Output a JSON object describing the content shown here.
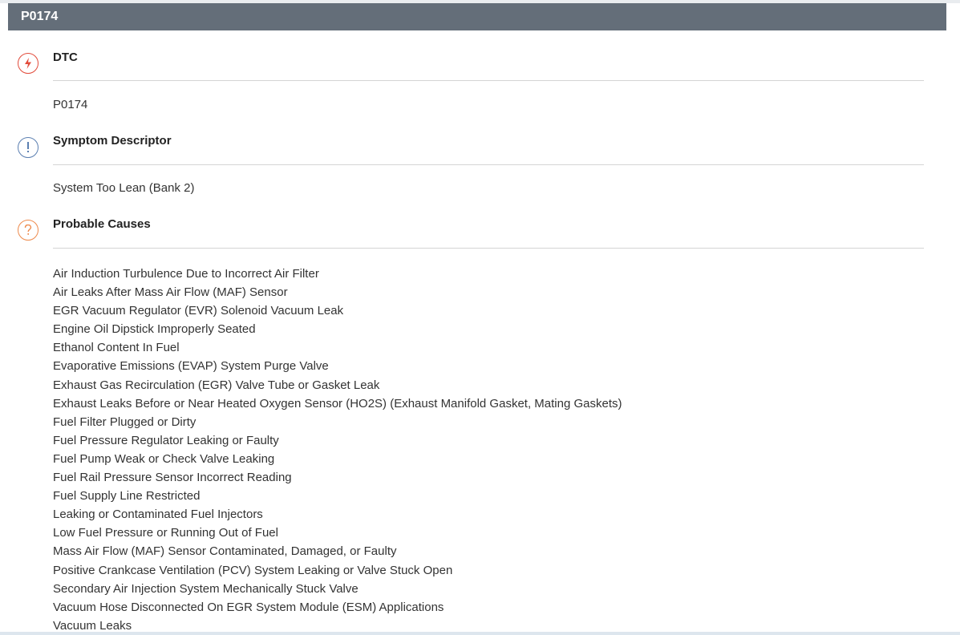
{
  "header": {
    "code": "P0174"
  },
  "sections": {
    "dtc": {
      "icon": "lightning-icon",
      "color": "#e24b3b",
      "title": "DTC",
      "value": "P0174"
    },
    "symptom": {
      "icon": "exclamation-icon",
      "color": "#5b7fb1",
      "title": "Symptom Descriptor",
      "value": "System Too Lean (Bank 2)"
    },
    "causes": {
      "icon": "question-icon",
      "color": "#ee8a4c",
      "title": "Probable Causes",
      "items": [
        "Air Induction Turbulence Due to Incorrect Air Filter",
        "Air Leaks After Mass Air Flow (MAF) Sensor",
        "EGR Vacuum Regulator (EVR) Solenoid Vacuum Leak",
        "Engine Oil Dipstick Improperly Seated",
        "Ethanol Content In Fuel",
        "Evaporative Emissions (EVAP) System Purge Valve",
        "Exhaust Gas Recirculation (EGR) Valve Tube or Gasket Leak",
        "Exhaust Leaks Before or Near Heated Oxygen Sensor (HO2S) (Exhaust Manifold Gasket, Mating Gaskets)",
        "Fuel Filter Plugged or Dirty",
        "Fuel Pressure Regulator Leaking or Faulty",
        "Fuel Pump Weak or Check Valve Leaking",
        "Fuel Rail Pressure Sensor Incorrect Reading",
        "Fuel Supply Line Restricted",
        "Leaking or Contaminated Fuel Injectors",
        "Low Fuel Pressure or Running Out of Fuel",
        "Mass Air Flow (MAF) Sensor Contaminated, Damaged, or Faulty",
        "Positive Crankcase Ventilation (PCV) System Leaking or Valve Stuck Open",
        "Secondary Air Injection System Mechanically Stuck Valve",
        "Vacuum Hose Disconnected On EGR System Module (ESM) Applications",
        "Vacuum Leaks"
      ]
    }
  }
}
